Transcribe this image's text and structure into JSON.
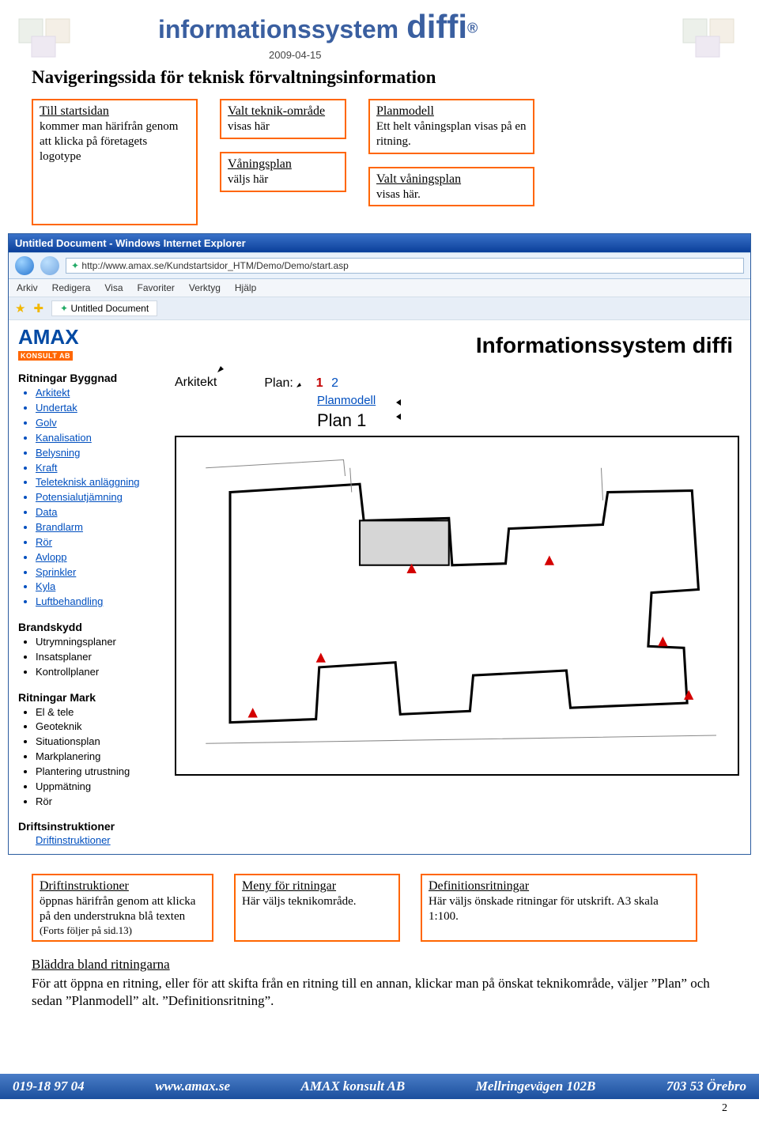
{
  "header": {
    "title_prefix": "informationssystem",
    "title_main": "diffi",
    "registered": "®",
    "date": "2009-04-15"
  },
  "page_title": "Navigeringssida för teknisk förvaltningsinformation",
  "callouts": {
    "start": {
      "caption": "Till startsidan",
      "text": "kommer man härifrån genom att klicka på företagets logotype"
    },
    "teknik": {
      "caption": "Valt teknik-område",
      "text": "visas här"
    },
    "vaning": {
      "caption": "Våningsplan",
      "text": "väljs här"
    },
    "planmodell": {
      "caption": "Planmodell",
      "text": "Ett helt våningsplan visas på en ritning."
    },
    "valt_vaning": {
      "caption": "Valt våningsplan",
      "text": "visas här."
    }
  },
  "ie": {
    "title": "Untitled Document - Windows Internet Explorer",
    "url": "http://www.amax.se/Kundstartsidor_HTM/Demo/Demo/start.asp",
    "menus": [
      "Arkiv",
      "Redigera",
      "Visa",
      "Favoriter",
      "Verktyg",
      "Hjälp"
    ],
    "tab": "Untitled Document"
  },
  "logo": {
    "brand": "AMAX",
    "sub": "KONSULT AB"
  },
  "sidebar": {
    "sections": [
      {
        "heading": "Ritningar Byggnad",
        "items": [
          {
            "label": "Arkitekt",
            "link": true
          },
          {
            "label": "Undertak",
            "link": true
          },
          {
            "label": "Golv",
            "link": true
          },
          {
            "label": "Kanalisation",
            "link": true
          },
          {
            "label": "Belysning",
            "link": true
          },
          {
            "label": "Kraft",
            "link": true
          },
          {
            "label": "Teleteknisk anläggning",
            "link": true
          },
          {
            "label": "Potensialutjämning",
            "link": true
          },
          {
            "label": "Data",
            "link": true
          },
          {
            "label": "Brandlarm",
            "link": true
          },
          {
            "label": "Rör",
            "link": true
          },
          {
            "label": "Avlopp",
            "link": true
          },
          {
            "label": "Sprinkler",
            "link": true
          },
          {
            "label": "Kyla",
            "link": true
          },
          {
            "label": "Luftbehandling",
            "link": true
          }
        ]
      },
      {
        "heading": "Brandskydd",
        "items": [
          {
            "label": "Utrymningsplaner",
            "link": false
          },
          {
            "label": "Insatsplaner",
            "link": false
          },
          {
            "label": "Kontrollplaner",
            "link": false
          }
        ]
      },
      {
        "heading": "Ritningar Mark",
        "items": [
          {
            "label": "El & tele",
            "link": false
          },
          {
            "label": "Geoteknik",
            "link": false
          },
          {
            "label": "Situationsplan",
            "link": false
          },
          {
            "label": "Markplanering",
            "link": false
          },
          {
            "label": "Plantering utrustning",
            "link": false
          },
          {
            "label": "Uppmätning",
            "link": false
          },
          {
            "label": "Rör",
            "link": false
          }
        ]
      },
      {
        "heading": "Driftsinstruktioner",
        "standalone": {
          "label": "Driftinstruktioner",
          "link": true
        }
      }
    ]
  },
  "main": {
    "title": "Informationssystem diffi",
    "arkitekt": "Arkitekt",
    "plan_label": "Plan:",
    "plan_1": "1",
    "plan_2": "2",
    "planmodell": "Planmodell",
    "plan1_big": "Plan 1"
  },
  "bottom_callouts": {
    "drift": {
      "caption": "Driftinstruktioner",
      "text": "öppnas härifrån genom att klicka på den understrukna blå texten",
      "note": "(Forts följer på sid.13)"
    },
    "meny": {
      "caption": "Meny för ritningar",
      "text": "Här väljs teknikområde."
    },
    "def": {
      "caption": "Definitionsritningar",
      "text": "Här väljs önskade ritningar för utskrift. A3 skala 1:100."
    }
  },
  "bottom_para": {
    "heading": "Bläddra bland ritningarna",
    "text": "För att öppna en ritning, eller för att skifta från en ritning till en annan, klickar man på önskat teknikområde, väljer ”Plan” och sedan ”Planmodell” alt. ”Definitionsritning”."
  },
  "footer": {
    "phone": "019-18 97 04",
    "web": "www.amax.se",
    "company": "AMAX konsult AB",
    "addr": "Mellringevägen 102B",
    "post": "703 53 Örebro"
  },
  "page_number": "2"
}
